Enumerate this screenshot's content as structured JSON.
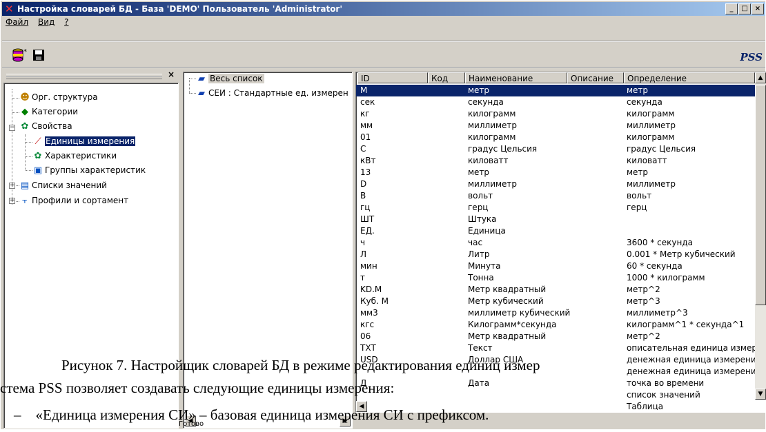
{
  "window": {
    "title": "Настройка словарей БД - База 'DEMO' Пользователь 'Administrator'",
    "buttons": [
      "_",
      "□",
      "×"
    ]
  },
  "menu": [
    "Файл",
    "Вид",
    "?"
  ],
  "toolbar": {
    "brand": "PSS"
  },
  "left_tree": {
    "close": "×",
    "items": [
      {
        "label": "Орг. структура"
      },
      {
        "label": "Категории"
      },
      {
        "label": "Свойства"
      },
      {
        "label": "Единицы измерения"
      },
      {
        "label": "Характеристики"
      },
      {
        "label": "Группы характеристик"
      },
      {
        "label": "Списки значений"
      },
      {
        "label": "Профили и сортамент"
      }
    ]
  },
  "middle_tree": {
    "items": [
      {
        "label": "Весь список"
      },
      {
        "label": "СЕИ : Стандартные ед. измерен"
      }
    ]
  },
  "grid": {
    "columns": [
      "ID",
      "Код",
      "Наименование",
      "Описание",
      "Определение"
    ],
    "rows": [
      [
        "М",
        "",
        "метр",
        "",
        "метр"
      ],
      [
        "сек",
        "",
        "секунда",
        "",
        "секунда"
      ],
      [
        "кг",
        "",
        "килограмм",
        "",
        "килограмм"
      ],
      [
        "мм",
        "",
        "миллиметр",
        "",
        "миллиметр"
      ],
      [
        "01",
        "",
        "килограмм",
        "",
        "килограмм"
      ],
      [
        "С",
        "",
        "градус Цельсия",
        "",
        "градус Цельсия"
      ],
      [
        "кВт",
        "",
        "киловатт",
        "",
        "киловатт"
      ],
      [
        "13",
        "",
        "метр",
        "",
        "метр"
      ],
      [
        "D",
        "",
        "миллиметр",
        "",
        "миллиметр"
      ],
      [
        "B",
        "",
        "вольт",
        "",
        "вольт"
      ],
      [
        "гц",
        "",
        "герц",
        "",
        "герц"
      ],
      [
        "ШТ",
        "",
        "Штука",
        "",
        ""
      ],
      [
        "ЕД.",
        "",
        "Единица",
        "",
        ""
      ],
      [
        "ч",
        "",
        "час",
        "",
        "3600 * секунда"
      ],
      [
        "Л",
        "",
        "Литр",
        "",
        "0.001 * Метр кубический"
      ],
      [
        "мин",
        "",
        "Минута",
        "",
        "60 * секунда"
      ],
      [
        "т",
        "",
        "Тонна",
        "",
        "1000 * килограмм"
      ],
      [
        "KD.M",
        "",
        "Метр квадратный",
        "",
        "метр^2"
      ],
      [
        "Куб. М",
        "",
        "Метр кубический",
        "",
        "метр^3"
      ],
      [
        "мм3",
        "",
        "миллиметр кубический",
        "",
        "миллиметр^3"
      ],
      [
        "кгс",
        "",
        "Килограмм*секунда",
        "",
        "килограмм^1 * секунда^1"
      ],
      [
        "06",
        "",
        "Метр квадратный",
        "",
        "метр^2"
      ],
      [
        "ТХТ",
        "",
        "Текст",
        "",
        "описательная единица измере"
      ],
      [
        "USD",
        "",
        "Доллар США",
        "",
        "денежная единица измерения"
      ],
      [
        "",
        "",
        "",
        "",
        "денежная единица измерения"
      ],
      [
        "Д",
        "",
        "Дата",
        "",
        "точка во времени"
      ],
      [
        "",
        "",
        "",
        "",
        "список значений"
      ],
      [
        "",
        "",
        "",
        "",
        "Таблица"
      ]
    ]
  },
  "status": {
    "text": "Готово"
  },
  "document_overlay": {
    "caption": "Рисунок 7. Настройщик словарей БД в режиме редактирования единиц измер",
    "line2": "стема PSS позволяет создавать следующие единицы измерения:",
    "line3": "«Единица измерения СИ» – базовая единица измерения СИ с префиксом."
  }
}
